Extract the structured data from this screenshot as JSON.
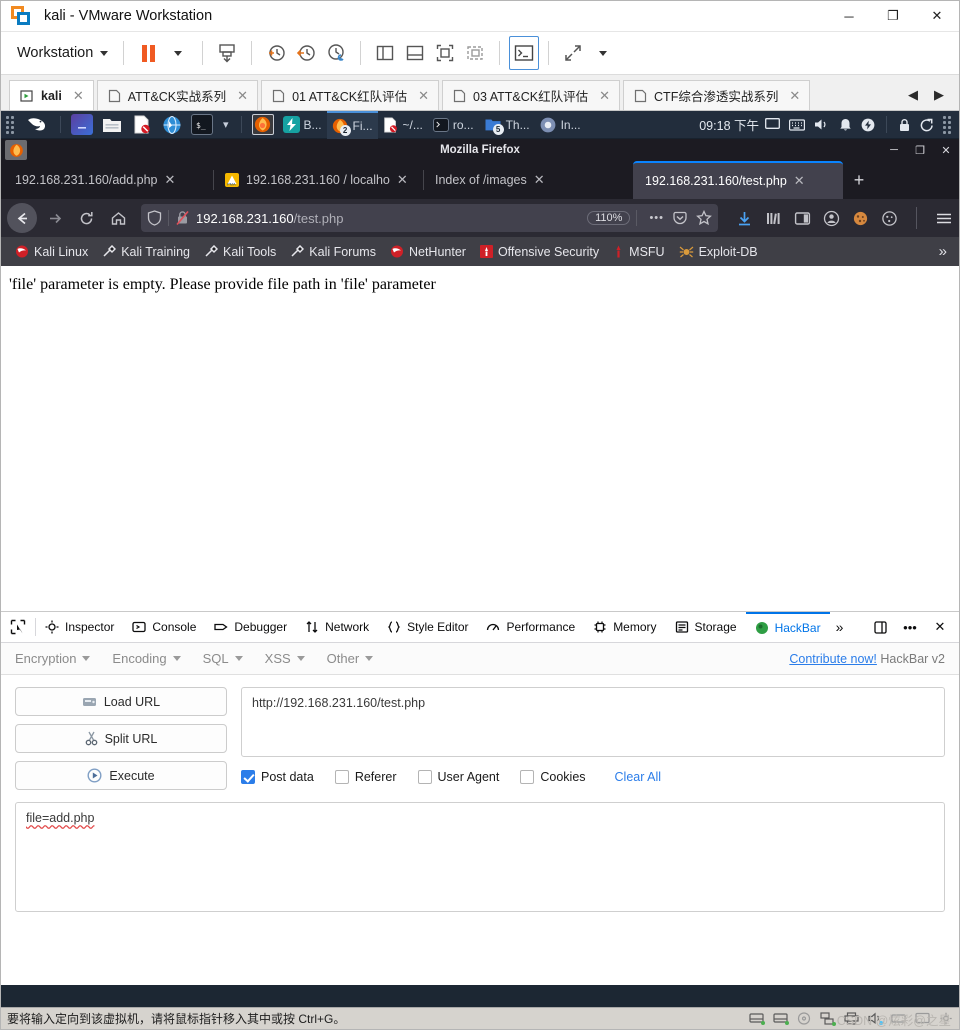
{
  "vmware": {
    "title": "kali - VMware Workstation",
    "menu_label": "Workstation",
    "window_controls": {
      "minimize": "─",
      "maximize": "❐",
      "close": "✕"
    },
    "tabs": [
      {
        "label": "kali",
        "icon": "vm-running-icon",
        "active": true
      },
      {
        "label": "ATT&CK实战系列",
        "icon": "folder-tab-icon",
        "active": false
      },
      {
        "label": "01 ATT&CK红队评估",
        "icon": "folder-tab-icon",
        "active": false
      },
      {
        "label": "03 ATT&CK红队评估",
        "icon": "folder-tab-icon",
        "active": false
      },
      {
        "label": "CTF综合渗透实战系列",
        "icon": "folder-tab-icon",
        "active": false
      }
    ],
    "tab_nav": {
      "prev": "◀",
      "next": "▶"
    },
    "status_text": "要将输入定向到该虚拟机，请将鼠标指针移入其中或按 Ctrl+G。",
    "watermark": "CSDN @炫彩@之星"
  },
  "kali_panel": {
    "clock": "09:18 下午",
    "launchers": [
      "kali-dragon-icon",
      "terminal-icon",
      "files-icon",
      "text-editor-icon",
      "browser-icon",
      "terminal-dropdown-icon"
    ],
    "firefox_launcher": "firefox-icon",
    "tasks": [
      {
        "label": "B...",
        "icon": "burp-icon",
        "badge": ""
      },
      {
        "label": "Fi...",
        "icon": "firefox-icon",
        "badge": "2",
        "focused": true
      },
      {
        "label": "~/...",
        "icon": "text-editor-icon",
        "badge": ""
      },
      {
        "label": "ro...",
        "icon": "terminal-icon",
        "badge": ""
      },
      {
        "label": "Th...",
        "icon": "files-icon",
        "badge": "5"
      },
      {
        "label": "In...",
        "icon": "chromium-icon",
        "badge": ""
      }
    ],
    "tray": [
      "display-icon",
      "keyboard-icon",
      "volume-icon",
      "notification-icon",
      "power-icon",
      "lock-icon",
      "logout-icon",
      "grip-icon"
    ]
  },
  "firefox": {
    "window_title": "Mozilla Firefox",
    "window_controls": {
      "minimize": "─",
      "maximize": "❐",
      "close": "✕"
    },
    "tabs": [
      {
        "label": "192.168.231.160/add.php",
        "favicon": "none",
        "active": false
      },
      {
        "label": "192.168.231.160 / localho",
        "favicon": "phpmyadmin-icon",
        "active": false
      },
      {
        "label": "Index of /images",
        "favicon": "none",
        "active": false
      },
      {
        "label": "192.168.231.160/test.php",
        "favicon": "none",
        "active": true
      }
    ],
    "new_tab_label": "+",
    "nav": {
      "back": "back-icon",
      "forward": "forward-icon",
      "reload": "reload-icon",
      "home": "home-icon",
      "url_host": "192.168.231.160",
      "url_path": "/test.php",
      "zoom_level": "110%",
      "shield": "shield-icon",
      "insecure_lock": "insecure-lock-icon",
      "more": "•••",
      "pocket": "pocket-icon",
      "bookmark_star": "star-icon",
      "toolbar_icons": [
        "downloads-icon",
        "library-icon",
        "sidebar-icon",
        "account-icon",
        "cookie-orange-icon",
        "cookie-white-icon",
        "hamburger-menu-icon"
      ]
    },
    "bookmarks": [
      {
        "label": "Kali Linux",
        "icon": "kali-dragon-icon"
      },
      {
        "label": "Kali Training",
        "icon": "kali-tool-icon"
      },
      {
        "label": "Kali Tools",
        "icon": "kali-tool-icon"
      },
      {
        "label": "Kali Forums",
        "icon": "kali-tool-icon"
      },
      {
        "label": "NetHunter",
        "icon": "kali-dragon-icon"
      },
      {
        "label": "Offensive Security",
        "icon": "offsec-icon"
      },
      {
        "label": "MSFU",
        "icon": "metasploit-icon"
      },
      {
        "label": "Exploit-DB",
        "icon": "exploitdb-icon"
      }
    ],
    "bookmarks_overflow": "»",
    "page_body_text": "'file' parameter is empty. Please provide file path in 'file' parameter"
  },
  "devtools": {
    "picker_icon": "element-picker-icon",
    "tabs": [
      {
        "label": "Inspector",
        "icon": "inspector-icon",
        "active": false
      },
      {
        "label": "Console",
        "icon": "console-icon",
        "active": false
      },
      {
        "label": "Debugger",
        "icon": "debugger-icon",
        "active": false
      },
      {
        "label": "Network",
        "icon": "network-icon",
        "active": false
      },
      {
        "label": "Style Editor",
        "icon": "style-editor-icon",
        "active": false
      },
      {
        "label": "Performance",
        "icon": "performance-icon",
        "active": false
      },
      {
        "label": "Memory",
        "icon": "memory-icon",
        "active": false
      },
      {
        "label": "Storage",
        "icon": "storage-icon",
        "active": false
      },
      {
        "label": "HackBar",
        "icon": "hackbar-icon",
        "active": true
      }
    ],
    "overflow": "»",
    "dock_icon": "dock-icon",
    "meatball": "•••",
    "close": "✕"
  },
  "hackbar": {
    "menus": [
      "Encryption",
      "Encoding",
      "SQL",
      "XSS",
      "Other"
    ],
    "contribute_label": "Contribute now!",
    "version_label": "HackBar v2",
    "buttons": [
      {
        "label": "Load URL",
        "icon": "load-url-icon"
      },
      {
        "label": "Split URL",
        "icon": "split-url-icon"
      },
      {
        "label": "Execute",
        "icon": "execute-icon"
      }
    ],
    "url_value": "http://192.168.231.160/test.php",
    "url_placeholder": "http://",
    "checkboxes": [
      {
        "label": "Post data",
        "checked": true
      },
      {
        "label": "Referer",
        "checked": false
      },
      {
        "label": "User Agent",
        "checked": false
      },
      {
        "label": "Cookies",
        "checked": false
      }
    ],
    "clear_all_label": "Clear All",
    "post_data_value": "file=add.php",
    "post_data_placeholder": ""
  },
  "colors": {
    "accent_blue": "#0074e8",
    "link_blue": "#2b7de9",
    "firefox_chrome": "#2b2a33",
    "kali_panel": "#222d3c",
    "vmware_orange": "#f05a22"
  }
}
